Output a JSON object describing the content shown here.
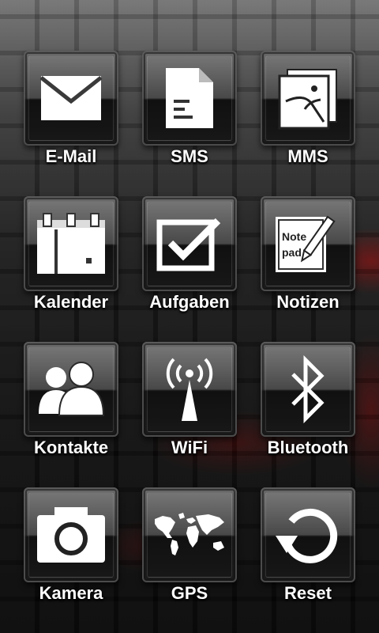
{
  "apps": [
    {
      "label": "E-Mail",
      "icon": "envelope-icon"
    },
    {
      "label": "SMS",
      "icon": "document-icon"
    },
    {
      "label": "MMS",
      "icon": "picture-stack-icon"
    },
    {
      "label": "Kalender",
      "icon": "calendar-icon"
    },
    {
      "label": "Aufgaben",
      "icon": "checkbox-icon"
    },
    {
      "label": "Notizen",
      "icon": "notepad-pen-icon"
    },
    {
      "label": "Kontakte",
      "icon": "people-icon"
    },
    {
      "label": "WiFi",
      "icon": "antenna-signal-icon"
    },
    {
      "label": "Bluetooth",
      "icon": "bluetooth-icon"
    },
    {
      "label": "Kamera",
      "icon": "camera-icon"
    },
    {
      "label": "GPS",
      "icon": "world-map-icon"
    },
    {
      "label": "Reset",
      "icon": "refresh-arrow-icon"
    }
  ],
  "notepad_text": {
    "line1": "Note",
    "line2": "pad"
  },
  "colors": {
    "label": "#ffffff",
    "accent_glow": "#c80000"
  }
}
